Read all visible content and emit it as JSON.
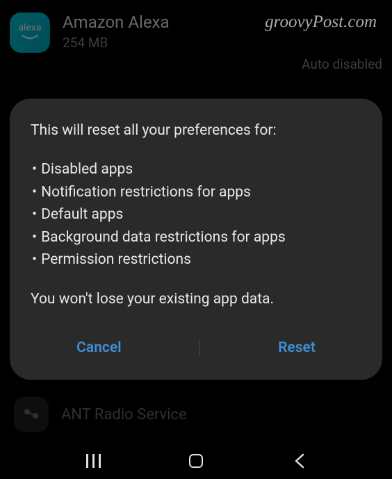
{
  "watermark": "groovyPost.com",
  "background": {
    "app": {
      "name": "Amazon Alexa",
      "size": "254 MB",
      "status": "Auto disabled",
      "icon_label": "alexa"
    },
    "row2": {
      "name": "ANT Radio Service"
    }
  },
  "dialog": {
    "title": "This will reset all your preferences for:",
    "items": [
      "Disabled apps",
      "Notification restrictions for apps",
      "Default apps",
      "Background data restrictions for apps",
      "Permission restrictions"
    ],
    "note": "You won't lose your existing app data.",
    "cancel": "Cancel",
    "reset": "Reset"
  }
}
